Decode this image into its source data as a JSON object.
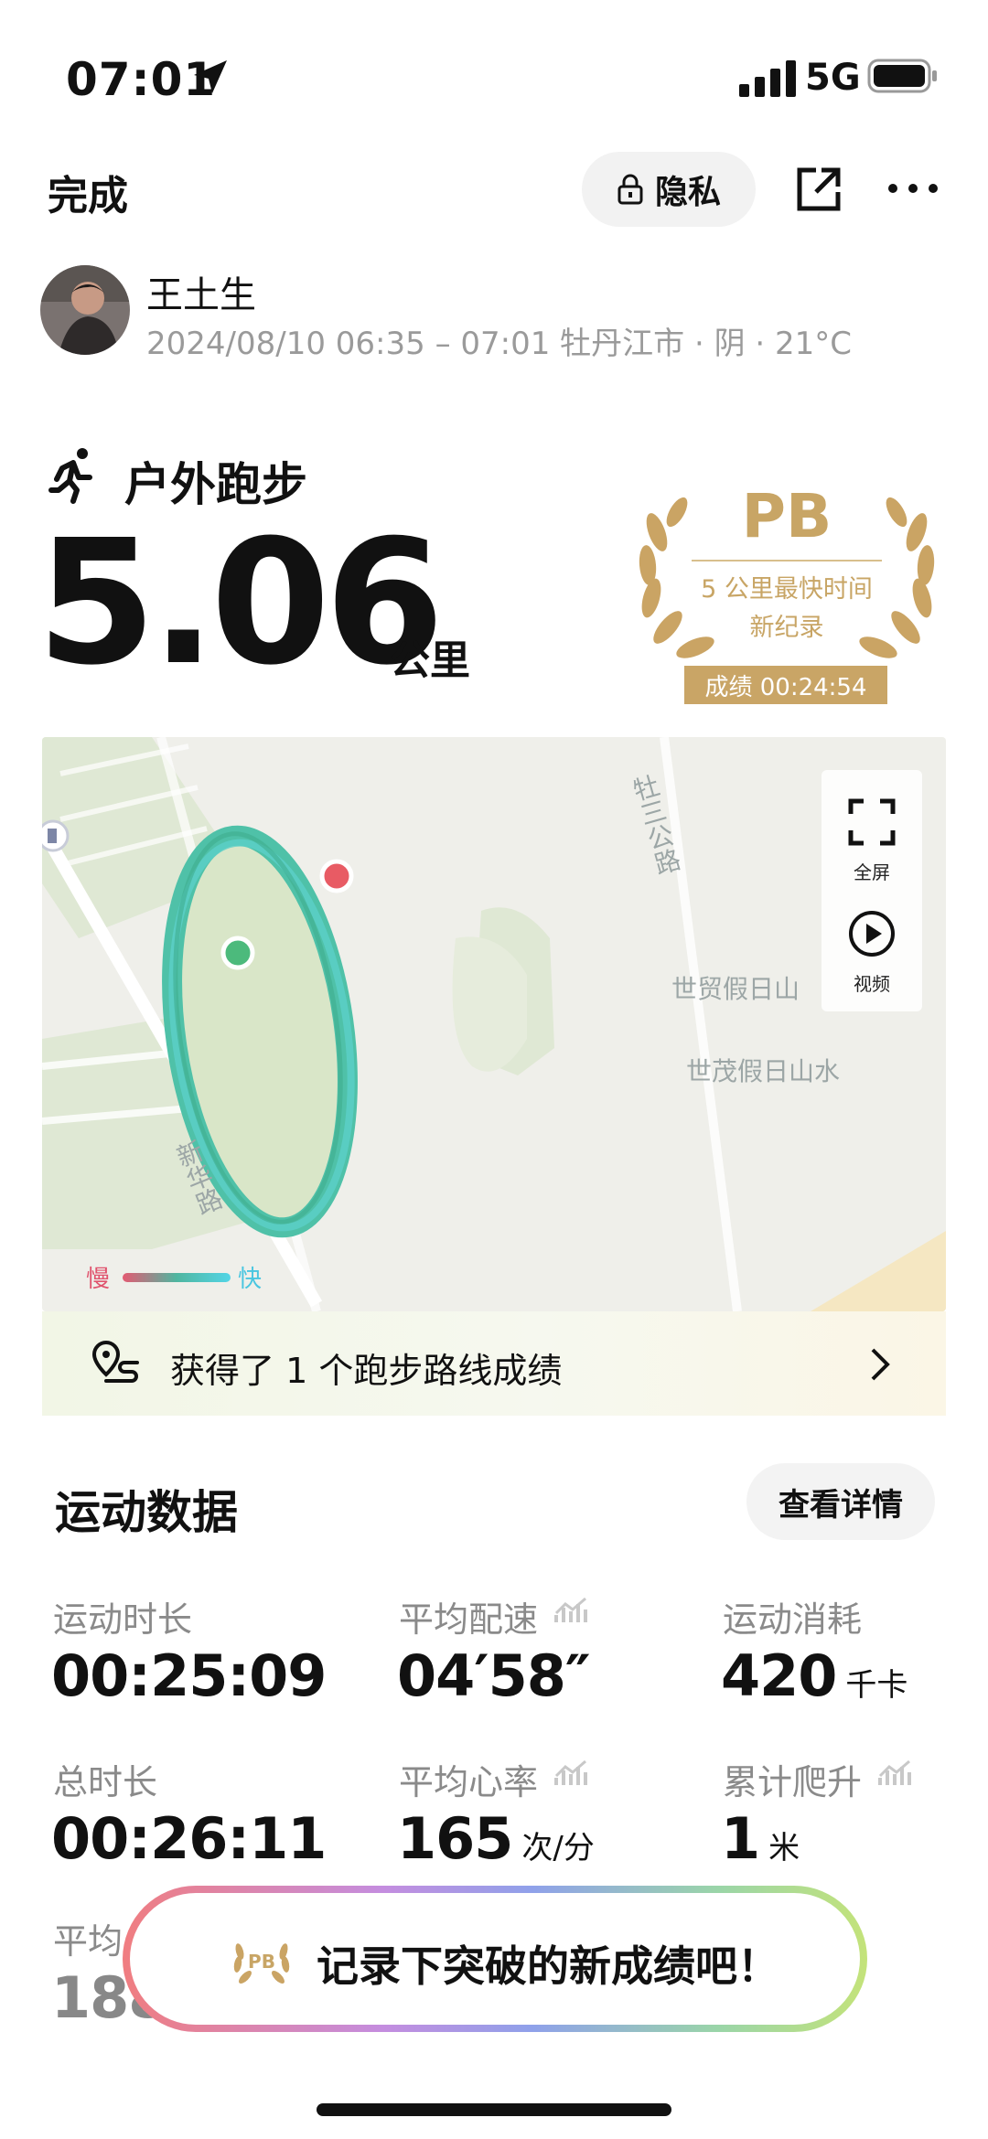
{
  "status_bar": {
    "time": "07:01",
    "network": "5G"
  },
  "top_bar": {
    "done_label": "完成",
    "privacy_label": "隐私"
  },
  "user": {
    "name": "王土生",
    "meta": "2024/08/10 06:35 – 07:01 牡丹江市 · 阴 · 21°C"
  },
  "activity": {
    "type": "户外跑步",
    "distance": "5.06",
    "distance_unit": "公里"
  },
  "pb_badge": {
    "title": "PB",
    "line1": "5 公里最快时间",
    "line2": "新纪录",
    "score": "成绩 00:24:54"
  },
  "map": {
    "fullscreen_label": "全屏",
    "video_label": "视频",
    "roads": [
      "牡三公路",
      "新华路"
    ],
    "places": [
      "世贸假日山",
      "世茂假日山水"
    ],
    "legend_slow": "慢",
    "legend_fast": "快"
  },
  "route_achievement": {
    "text": "获得了 1 个跑步路线成绩"
  },
  "section": {
    "title": "运动数据",
    "details_button": "查看详情"
  },
  "stats": {
    "duration": {
      "label": "运动时长",
      "value": "00:25:09"
    },
    "avg_pace": {
      "label": "平均配速",
      "value": "04′58″"
    },
    "calories": {
      "label": "运动消耗",
      "value": "420",
      "unit": "千卡"
    },
    "total_time": {
      "label": "总时长",
      "value": "00:26:11"
    },
    "avg_hr": {
      "label": "平均心率",
      "value": "165",
      "unit": "次/分"
    },
    "elevation": {
      "label": "累计爬升",
      "value": "1",
      "unit": "米"
    },
    "partial_label": "平均",
    "partial_value": "188"
  },
  "toast": {
    "text": "记录下突破的新成绩吧！"
  },
  "colors": {
    "pb_gold": "#c8a565",
    "route_teal": "#4fc1a8",
    "start_green": "#4cba7c",
    "end_red": "#e85b64"
  }
}
